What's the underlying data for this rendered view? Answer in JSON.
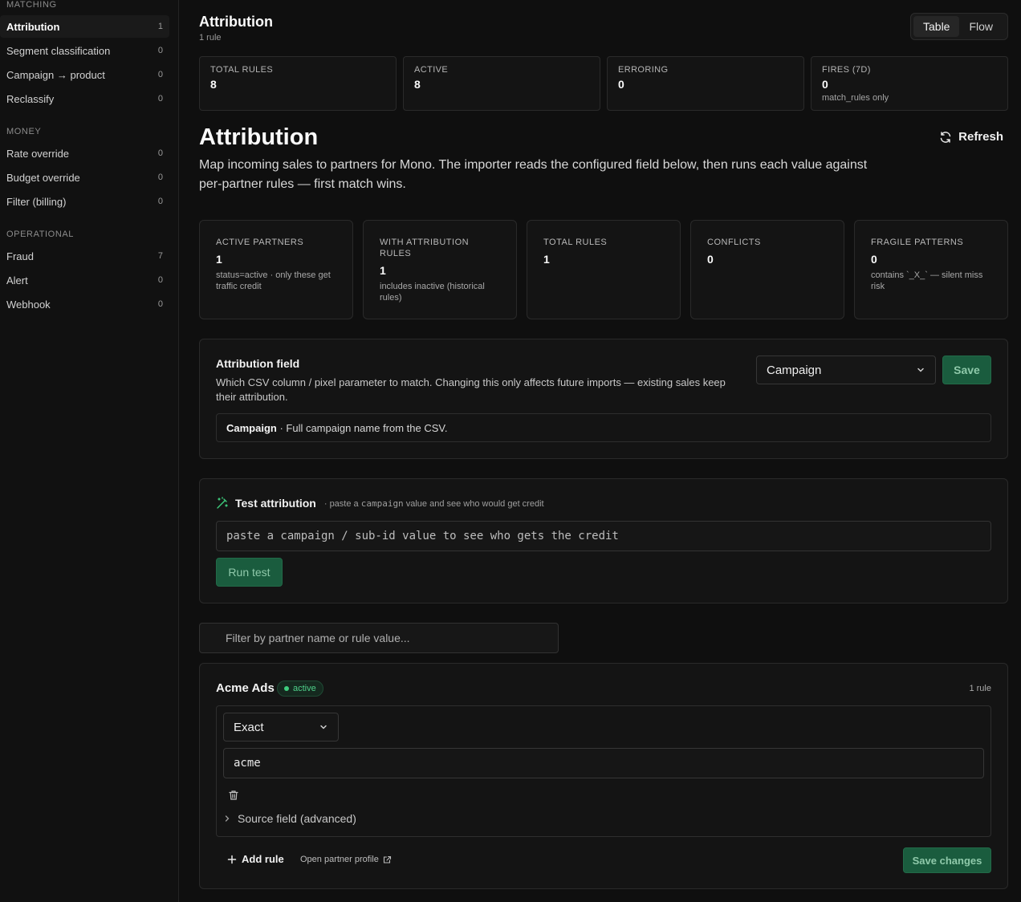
{
  "sidebar": {
    "sections": [
      {
        "title": "MATCHING",
        "items": [
          {
            "label": "Attribution",
            "count": "1"
          },
          {
            "label": "Segment classification",
            "count": "0"
          },
          {
            "label": "Campaign → product",
            "count": "0"
          },
          {
            "label": "Reclassify",
            "count": "0"
          }
        ]
      },
      {
        "title": "MONEY",
        "items": [
          {
            "label": "Rate override",
            "count": "0"
          },
          {
            "label": "Budget override",
            "count": "0"
          },
          {
            "label": "Filter (billing)",
            "count": "0"
          }
        ]
      },
      {
        "title": "OPERATIONAL",
        "items": [
          {
            "label": "Fraud",
            "count": "7"
          },
          {
            "label": "Alert",
            "count": "0"
          },
          {
            "label": "Webhook",
            "count": "0"
          }
        ]
      }
    ]
  },
  "header": {
    "title": "Attribution",
    "subtitle": "1 rule",
    "view_toggle": {
      "table": "Table",
      "flow": "Flow",
      "selected": "Table"
    }
  },
  "stats": [
    {
      "label": "TOTAL RULES",
      "value": "8",
      "note": ""
    },
    {
      "label": "ACTIVE",
      "value": "8",
      "note": ""
    },
    {
      "label": "ERRORING",
      "value": "0",
      "note": ""
    },
    {
      "label": "FIRES (7D)",
      "value": "0",
      "note": "match_rules only"
    }
  ],
  "section": {
    "title": "Attribution",
    "refresh_label": "Refresh",
    "description": "Map incoming sales to partners for Mono. The importer reads the configured field below, then runs each value against per-partner rules — first match wins."
  },
  "metrics": [
    {
      "label": "ACTIVE PARTNERS",
      "value": "1",
      "note": "status=active · only these get traffic credit"
    },
    {
      "label": "WITH ATTRIBUTION RULES",
      "value": "1",
      "note": "includes inactive (historical rules)"
    },
    {
      "label": "TOTAL RULES",
      "value": "1",
      "note": ""
    },
    {
      "label": "CONFLICTS",
      "value": "0",
      "note": ""
    },
    {
      "label": "FRAGILE PATTERNS",
      "value": "0",
      "note": "contains `_X_` — silent miss risk"
    }
  ],
  "attribution_field": {
    "title": "Attribution field",
    "description": "Which CSV column / pixel parameter to match. Changing this only affects future imports — existing sales keep their attribution.",
    "selected": "Campaign",
    "save_label": "Save",
    "info_name": "Campaign",
    "info_text": " · Full campaign name from the CSV."
  },
  "test": {
    "title": "Test attribution",
    "hint_prefix": "· paste a ",
    "hint_code": "campaign",
    "hint_suffix": " value and see who would get credit",
    "placeholder": "paste a campaign / sub-id value to see who gets the credit",
    "run_label": "Run test"
  },
  "filter": {
    "placeholder": "Filter by partner name or rule value..."
  },
  "partner": {
    "name": "Acme Ads",
    "status": "active",
    "rule_count": "1 rule",
    "match_type": "Exact",
    "rule_value": "acme",
    "source_field_label": "Source field (advanced)",
    "add_rule_label": "Add rule",
    "open_profile_label": "Open partner profile",
    "save_changes_label": "Save changes"
  },
  "colors": {
    "accent_green": "#1a5c3e",
    "status_green": "#3ecf7e",
    "background": "#0f0f0f"
  }
}
